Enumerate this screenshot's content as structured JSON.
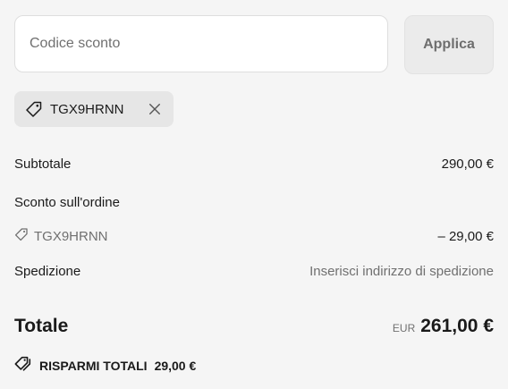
{
  "discount": {
    "placeholder": "Codice sconto",
    "value": "",
    "apply_label": "Applica"
  },
  "applied_code": {
    "code": "TGX9HRNN",
    "icon": "tag-icon",
    "remove_icon": "close-icon"
  },
  "summary": {
    "subtotal_label": "Subtotale",
    "subtotal_value": "290,00 €",
    "order_discount_label": "Sconto sull'ordine",
    "order_discount_code": "TGX9HRNN",
    "order_discount_value": "– 29,00 €",
    "shipping_label": "Spedizione",
    "shipping_value": "Inserisci indirizzo di spedizione"
  },
  "total": {
    "label": "Totale",
    "currency": "EUR",
    "amount": "261,00 €"
  },
  "savings": {
    "label": "RISPARMI TOTALI",
    "amount": "29,00 €",
    "icon": "tags-icon"
  },
  "colors": {
    "background": "#f5f5f5",
    "chip_background": "#e6e6e6",
    "muted_text": "#707070"
  }
}
